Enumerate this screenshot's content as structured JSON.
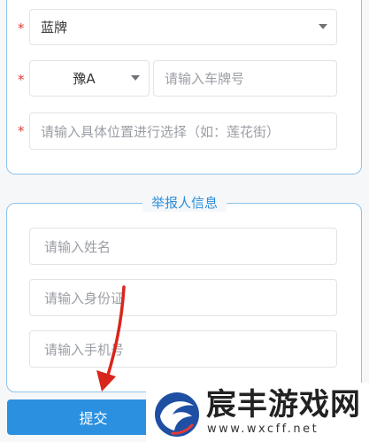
{
  "vehicle": {
    "required_mark": "*",
    "plate_color": {
      "value": "蓝牌",
      "icon": "caret-down-icon"
    },
    "plate_prefix": {
      "value": "豫A",
      "icon": "caret-down-icon"
    },
    "plate_number": {
      "placeholder": "请输入车牌号"
    },
    "location": {
      "placeholder": "请输入具体位置进行选择（如：莲花街）"
    }
  },
  "reporter": {
    "legend": "举报人信息",
    "name": {
      "placeholder": "请输入姓名"
    },
    "id_card": {
      "placeholder": "请输入身份证"
    },
    "phone": {
      "placeholder": "请输入手机号"
    }
  },
  "submit_label": "提交",
  "watermark": {
    "title": "宸丰游戏网",
    "url": "www.wxcff.net",
    "logo_color": "#1f4fa3"
  },
  "colors": {
    "accent": "#2b90df",
    "required": "#e53935",
    "annotation": "#d9261c"
  }
}
